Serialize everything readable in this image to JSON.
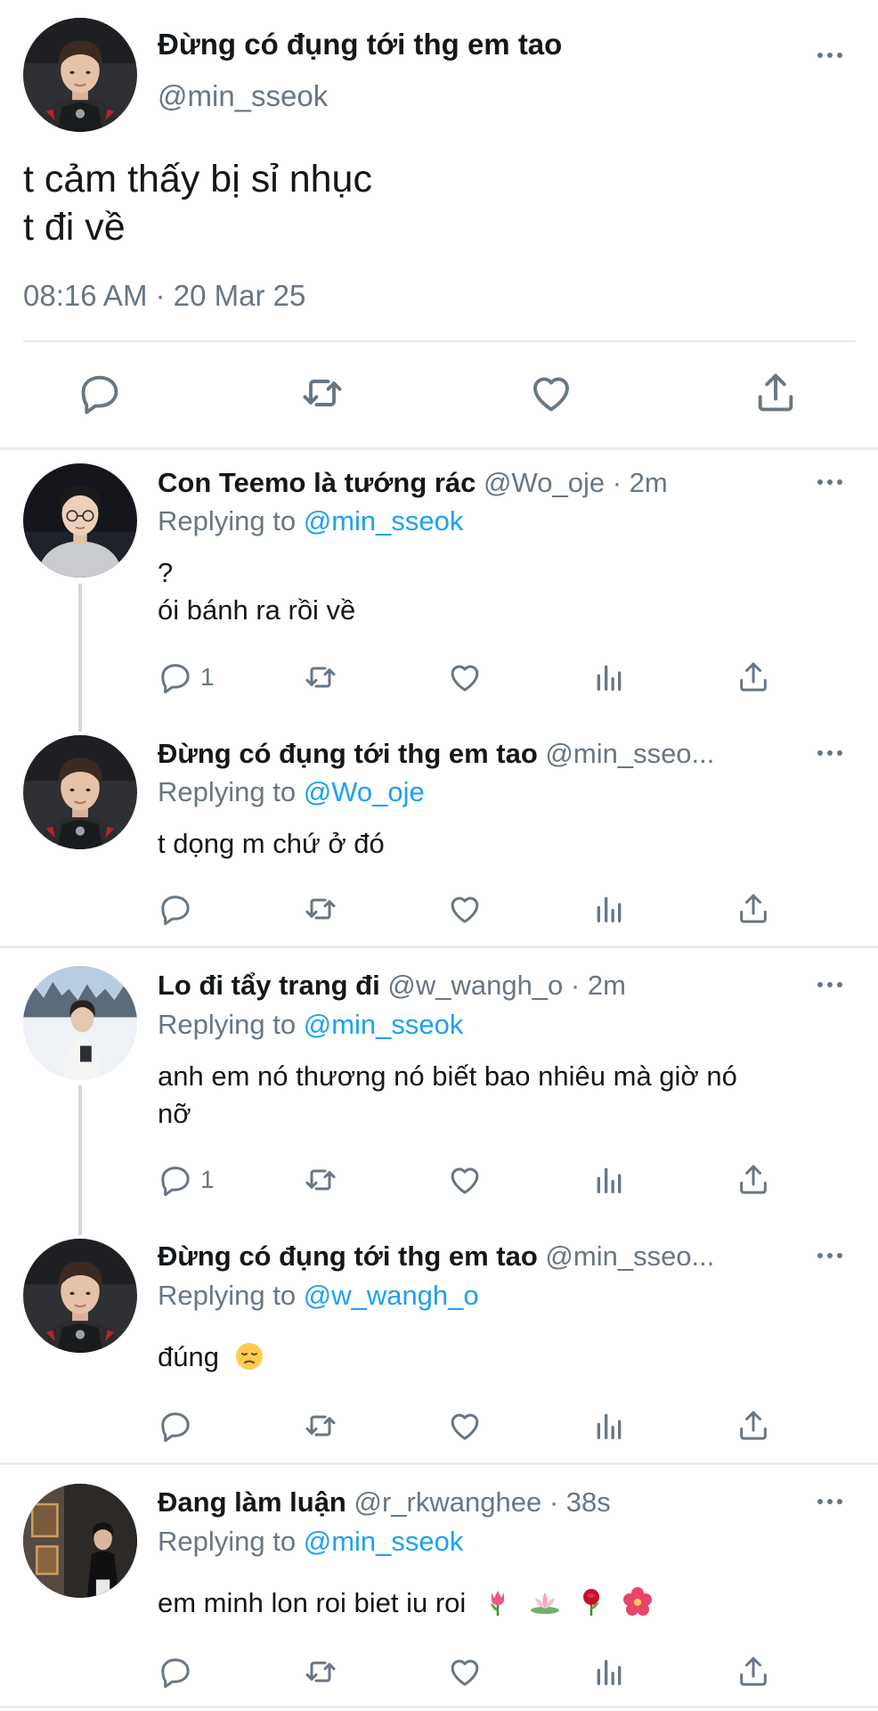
{
  "main_tweet": {
    "name": "Đừng có đụng tới thg em tao",
    "handle": "@min_sseok",
    "text_line1": "t cảm thấy bị sỉ nhục",
    "text_line2": "t đi về",
    "timestamp": "08:16 AM · 20 Mar 25"
  },
  "replies": [
    {
      "name": "Con Teemo là tướng rác",
      "handle": "@Wo_oje",
      "time": "· 2m",
      "replying_prefix": "Replying to",
      "replying_to": "@min_sseok",
      "text_line1": "?",
      "text_line2": "ói bánh ra rồi về",
      "reply_count": "1"
    },
    {
      "name": "Đừng có đụng tới thg em tao",
      "handle": "@min_sseo...",
      "time": "",
      "replying_prefix": "Replying to",
      "replying_to": "@Wo_oje",
      "text_line1": "t dọng m chứ ở đó",
      "reply_count": ""
    },
    {
      "name": "Lo đi tẩy trang đi",
      "handle": "@w_wangh_o",
      "time": "· 2m",
      "replying_prefix": "Replying to",
      "replying_to": "@min_sseok",
      "text_line1": "anh em nó thương nó biết bao nhiêu mà giờ nó",
      "text_line2": "nỡ",
      "reply_count": "1"
    },
    {
      "name": "Đừng có đụng tới thg em tao",
      "handle": "@min_sseo...",
      "time": "",
      "replying_prefix": "Replying to",
      "replying_to": "@w_wangh_o",
      "text_line1": "đúng",
      "reply_count": ""
    },
    {
      "name": "Đang làm luận",
      "handle": "@r_rkwanghee",
      "time": "· 38s",
      "replying_prefix": "Replying to",
      "replying_to": "@min_sseok",
      "text_line1": "em minh lon roi biet iu roi",
      "reply_count": ""
    }
  ],
  "colors": {
    "text": "#14171a",
    "secondary": "#687684",
    "link": "#1da1f2",
    "separator": "#e6ecf0"
  },
  "icons": [
    "reply-icon",
    "retweet-icon",
    "like-icon",
    "analytics-icon",
    "share-icon",
    "more-icon"
  ]
}
